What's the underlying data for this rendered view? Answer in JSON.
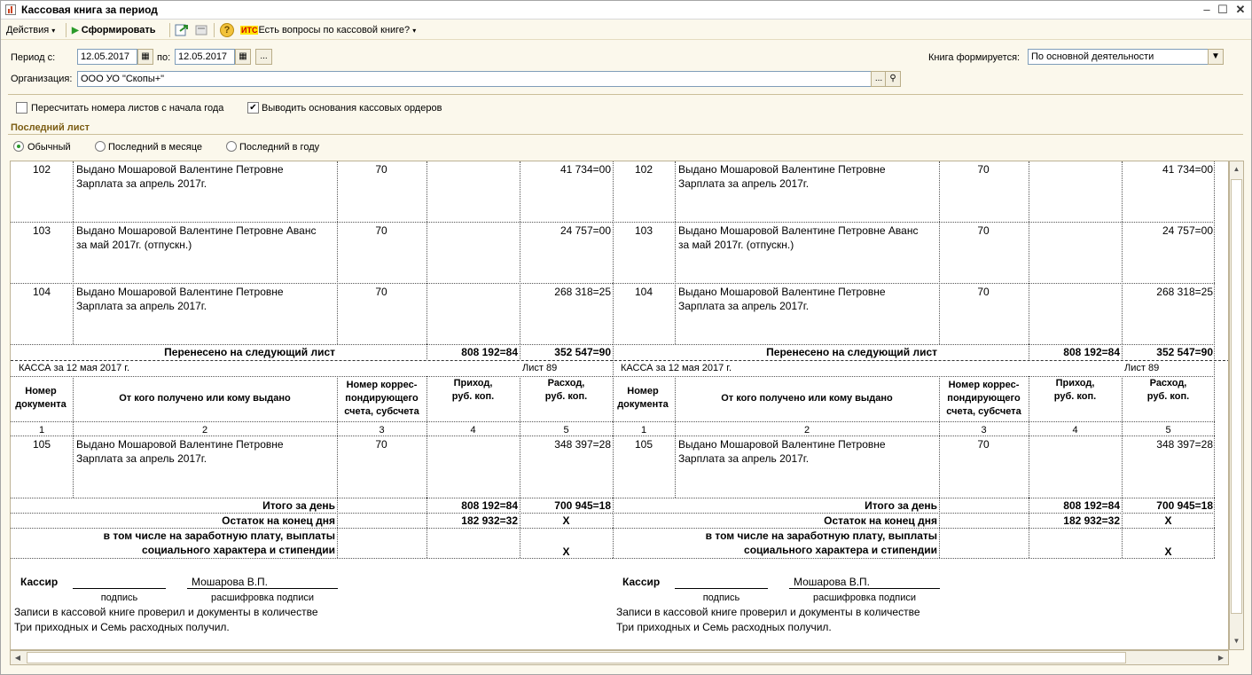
{
  "window": {
    "title": "Кассовая книга за период"
  },
  "toolbar": {
    "actions": "Действия",
    "generate": "Сформировать",
    "its_badge": "ИТС",
    "questions": "Есть вопросы по кассовой книге?"
  },
  "filters": {
    "period_from_label": "Период с:",
    "period_from": "12.05.2017",
    "period_to_label": "по:",
    "period_to": "12.05.2017",
    "more_button": "...",
    "org_label": "Организация:",
    "org_value": "ООО УО \"Скопы+\"",
    "book_label": "Книга формируется:",
    "book_value": "По основной деятельности"
  },
  "options": {
    "renumber": "Пересчитать номера листов с начала года",
    "renumber_checked": false,
    "show_basis": "Выводить основания кассовых ордеров",
    "show_basis_checked": true
  },
  "last_sheet": {
    "title": "Последний лист",
    "options": [
      "Обычный",
      "Последний в месяце",
      "Последний в году"
    ],
    "selected": "Обычный"
  },
  "report": {
    "rows_top": [
      {
        "num": "102",
        "line1": "Выдано Мошаровой Валентине Петровне",
        "line2": "Зарплата за апрель 2017г.",
        "acc": "70",
        "in": "",
        "out": "41 734=00"
      },
      {
        "num": "103",
        "line1": "Выдано Мошаровой Валентине Петровне Аванс",
        "line2": "за май 2017г. (отпускн.)",
        "acc": "70",
        "in": "",
        "out": "24 757=00"
      },
      {
        "num": "104",
        "line1": "Выдано Мошаровой Валентине Петровне",
        "line2": "Зарплата за апрель 2017г.",
        "acc": "70",
        "in": "",
        "out": "268 318=25"
      }
    ],
    "carried_label": "Перенесено на следующий лист",
    "carried_in": "808 192=84",
    "carried_out": "352 547=90",
    "kassa_date": "КАССА за 12 мая 2017 г.",
    "sheet_no": "Лист 89",
    "header": {
      "num1": "Номер",
      "num2": "документа",
      "who": "От кого получено или кому выдано",
      "acc1": "Номер коррес-",
      "acc2": "пондирующего",
      "acc3": "счета, субсчета",
      "in1": "Приход,",
      "in2": "руб. коп.",
      "out1": "Расход,",
      "out2": "руб. коп.",
      "cols": [
        "1",
        "2",
        "3",
        "4",
        "5"
      ]
    },
    "row_bottom": {
      "num": "105",
      "line1": "Выдано Мошаровой Валентине Петровне",
      "line2": "Зарплата за апрель 2017г.",
      "acc": "70",
      "in": "",
      "out": "348 397=28"
    },
    "total_label": "Итого за день",
    "total_in": "808 192=84",
    "total_out": "700 945=18",
    "balance_label": "Остаток на конец  дня",
    "balance_in": "182 932=32",
    "balance_out": "X",
    "incl_label1": "в том числе на заработную плату, выплаты",
    "incl_label2": "социального характера и стипендии",
    "incl_out": "X",
    "cashier_label": "Кассир",
    "signature_caption": "подпись",
    "cashier_name": "Мошарова В.П.",
    "name_caption": "расшифровка подписи",
    "check_line1": "Записи в кассовой книге проверил и документы в количестве",
    "check_line2": "Три приходных и Семь расходных получил."
  },
  "colors": {
    "window_bg": "#fbf8ec",
    "section_title": "#7b5c12",
    "generate_icon": "#2a9a2a"
  }
}
